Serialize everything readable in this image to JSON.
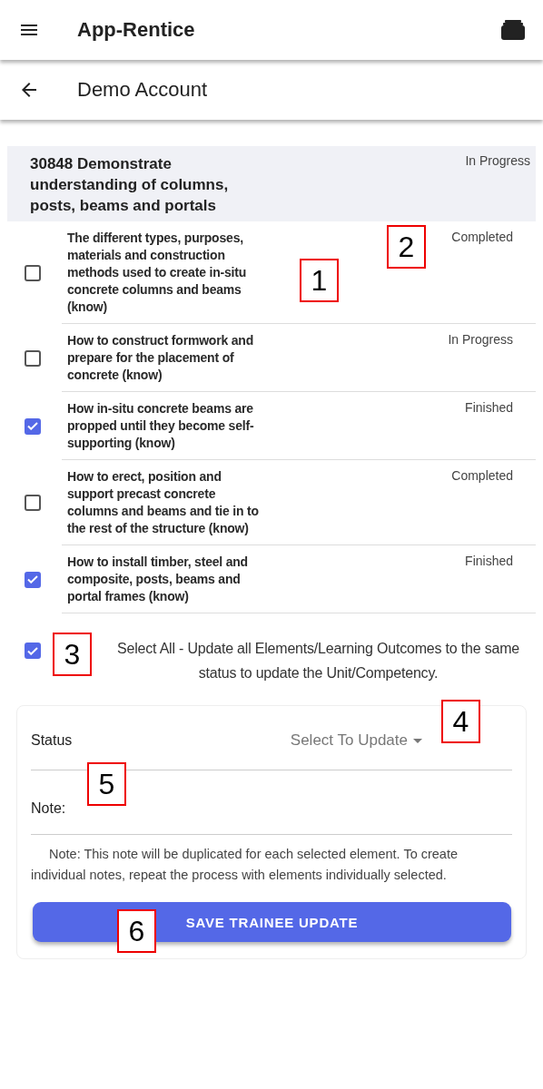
{
  "app_bar": {
    "title": "App-Rentice"
  },
  "sub_bar": {
    "title": "Demo Account"
  },
  "unit": {
    "title": "30848 Demonstrate understanding of columns, posts, beams and portals",
    "status": "In Progress"
  },
  "elements": [
    {
      "text": "The different types, purposes, materials and construction methods used to create in-situ concrete columns and beams (know)",
      "status": "Completed",
      "checked": false
    },
    {
      "text": "How to construct formwork and prepare for the placement of concrete (know)",
      "status": "In Progress",
      "checked": false
    },
    {
      "text": "How in-situ concrete beams are propped until they become self-supporting (know)",
      "status": "Finished",
      "checked": true
    },
    {
      "text": "How to erect, position and support precast concrete columns and beams and tie in to the rest of the structure (know)",
      "status": "Completed",
      "checked": false
    },
    {
      "text": "How to install timber, steel and composite, posts, beams and portal frames (know)",
      "status": "Finished",
      "checked": true
    }
  ],
  "select_all": {
    "checked": true,
    "text": "Select All - Update all Elements/Learning Outcomes to the same status to update the Unit/Competency."
  },
  "update_form": {
    "status_label": "Status",
    "status_placeholder": "Select To Update",
    "note_label": "Note:",
    "note_hint": "Note: This note will be duplicated for each selected element. To create individual notes, repeat the process with elements individually selected.",
    "button": "SAVE TRAINEE UPDATE"
  },
  "callouts": [
    "1",
    "2",
    "3",
    "4",
    "5",
    "6"
  ]
}
